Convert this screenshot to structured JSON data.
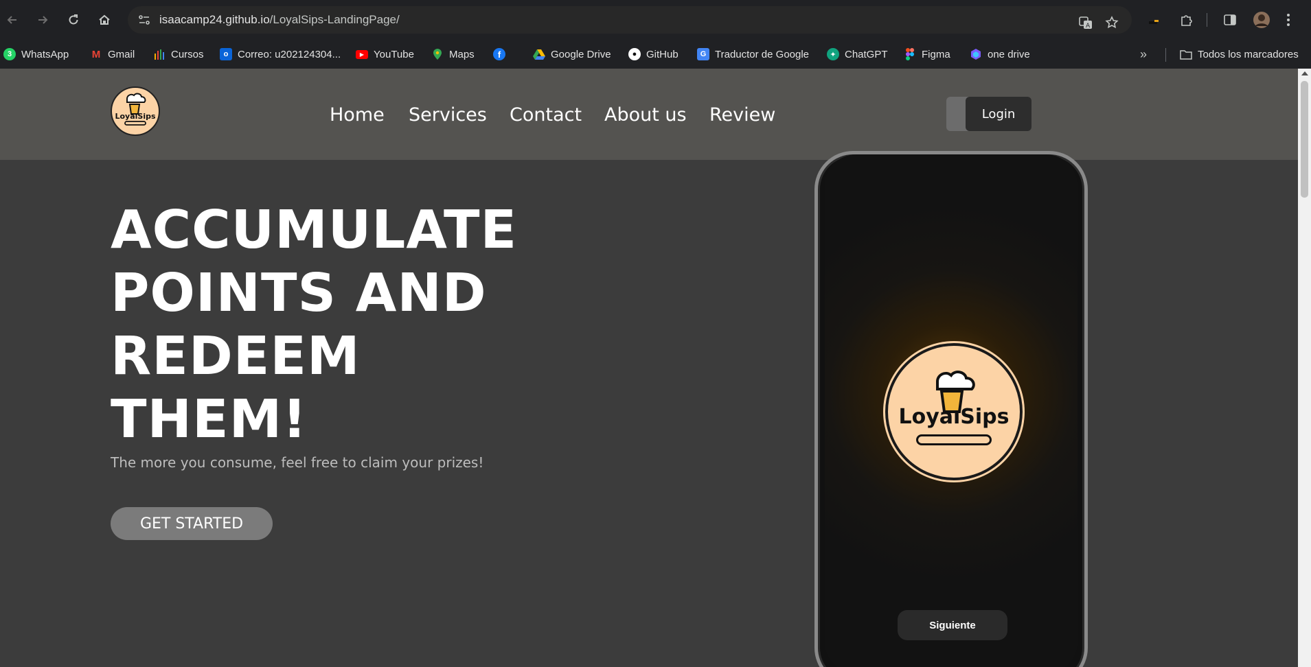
{
  "browser": {
    "url_host": "isaacamp24.github.io",
    "url_path": "/LoyalSips-LandingPage/",
    "bookmarks": [
      {
        "label": "WhatsApp",
        "icon": "whatsapp-icon",
        "color": "#25d366"
      },
      {
        "label": "Gmail",
        "icon": "gmail-icon",
        "color": "#ea4335"
      },
      {
        "label": "Cursos",
        "icon": "cursos-icon",
        "color": "#f9ab00"
      },
      {
        "label": "Correo: u202124304...",
        "icon": "outlook-icon",
        "color": "#0a64d8"
      },
      {
        "label": "YouTube",
        "icon": "youtube-icon",
        "color": "#ff0000"
      },
      {
        "label": "Maps",
        "icon": "maps-icon",
        "color": "#34a853"
      },
      {
        "label": "",
        "icon": "facebook-icon",
        "color": "#1877f2"
      },
      {
        "label": "Google Drive",
        "icon": "google-drive-icon",
        "color": "#fbbc04"
      },
      {
        "label": "GitHub",
        "icon": "github-icon",
        "color": "#ffffff"
      },
      {
        "label": "Traductor de Google",
        "icon": "google-translate-icon",
        "color": "#4285f4"
      },
      {
        "label": "ChatGPT",
        "icon": "chatgpt-icon",
        "color": "#10a37f"
      },
      {
        "label": "Figma",
        "icon": "figma-icon",
        "color": "#f24e1e"
      },
      {
        "label": "one drive",
        "icon": "onedrive-icon",
        "color": "#7b5cff"
      }
    ],
    "all_bookmarks_label": "Todos los marcadores"
  },
  "header": {
    "logo_text": "LoyalSips",
    "nav": [
      "Home",
      "Services",
      "Contact",
      "About us",
      "Review"
    ],
    "login_label": "Login"
  },
  "hero": {
    "title_lines": [
      "ACCUMULATE",
      "POINTS AND",
      "REDEEM",
      "THEM!"
    ],
    "subtitle": "The more you consume, feel free to claim your prizes!",
    "cta_label": "GET STARTED"
  },
  "phone": {
    "logo_text": "LoyalSips",
    "button_label": "Siguiente"
  }
}
